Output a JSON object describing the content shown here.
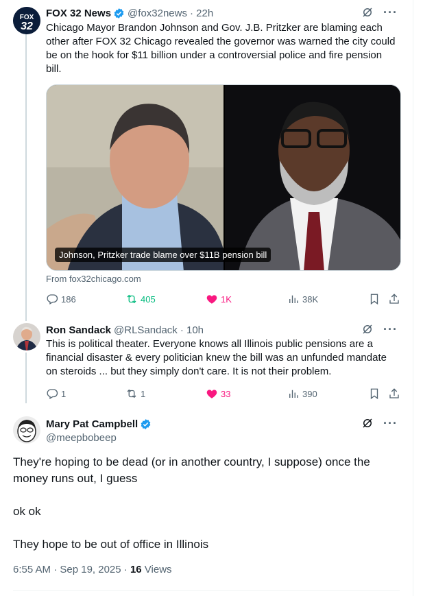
{
  "tweet1": {
    "name": "FOX 32 News",
    "handle": "@fox32news",
    "time": "· 22h",
    "avatar_text_top": "FOX",
    "avatar_text_bottom": "32",
    "text": "Chicago Mayor Brandon Johnson and Gov. J.B. Pritzker are blaming each other after FOX 32 Chicago revealed the governor was warned the city could be on the hook for $11 billion under a controversial police and fire pension bill.",
    "card_caption": "Johnson, Pritzker trade blame over $11B pension bill",
    "card_source": "From fox32chicago.com",
    "replies": "186",
    "reposts": "405",
    "likes": "1K",
    "views": "38K"
  },
  "tweet2": {
    "name": "Ron Sandack",
    "handle": "@RLSandack",
    "time": "· 10h",
    "text": "This is political theater.  Everyone knows all Illinois public pensions are a financial disaster & every politician knew the bill was an unfunded mandate on steroids ... but they simply don't care. It is not their problem.",
    "replies": "1",
    "reposts": "1",
    "likes": "33",
    "views": "390"
  },
  "tweet3": {
    "name": "Mary Pat Campbell",
    "handle": "@meepbobeep",
    "paragraph1": "They're hoping to be dead (or in another country, I suppose) once the money runs out, I guess",
    "paragraph2": "ok ok",
    "paragraph3": "They hope to be out of office in Illinois",
    "timestamp": "6:55 AM · Sep 19, 2025 · ",
    "views_count": "16",
    "views_label": " Views"
  },
  "colors": {
    "verified": "#1d9bf0",
    "repost_active": "#00ba7c",
    "like_active": "#f91880",
    "secondary_text": "#536471"
  }
}
